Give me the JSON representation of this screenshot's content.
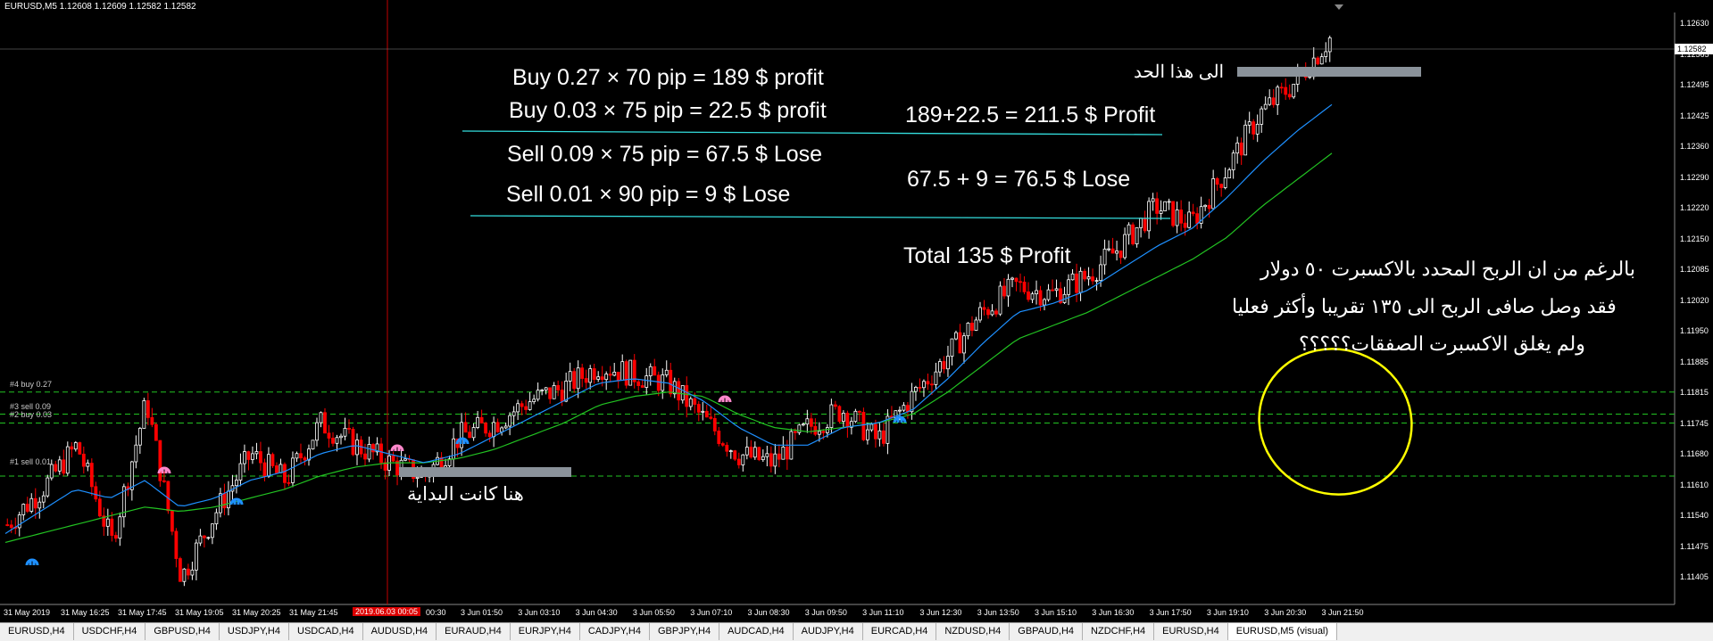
{
  "symbol_info": "EURUSD,M5  1.12608 1.12609 1.12582 1.12582",
  "current_price": "1.12582",
  "price_ticks": [
    "1.12630",
    "1.12565",
    "1.12495",
    "1.12425",
    "1.12360",
    "1.12290",
    "1.12220",
    "1.12150",
    "1.12085",
    "1.12020",
    "1.11950",
    "1.11885",
    "1.11815",
    "1.11745",
    "1.11680",
    "1.11610",
    "1.11540",
    "1.11475",
    "1.11405"
  ],
  "time_ticks": [
    "31 May 2019",
    "31 May 16:25",
    "31 May 17:45",
    "31 May 19:05",
    "31 May 20:25",
    "31 May 21:45",
    "2019.06.03 00:05",
    "00:30",
    "3 Jun 01:50",
    "3 Jun 03:10",
    "3 Jun 04:30",
    "3 Jun 05:50",
    "3 Jun 07:10",
    "3 Jun 08:30",
    "3 Jun 09:50",
    "3 Jun 11:10",
    "3 Jun 12:30",
    "3 Jun 13:50",
    "3 Jun 15:10",
    "3 Jun 16:30",
    "3 Jun 17:50",
    "3 Jun 19:10",
    "3 Jun 20:30",
    "3 Jun 21:50"
  ],
  "indicator_labels": [
    "#4 buy 0.27",
    "#3 sell 0.09",
    "#2 buy 0.03",
    "#1 sell 0.01"
  ],
  "annotations": {
    "calc1": "Buy 0.27 × 70 pip = 189 $ profit",
    "calc2": "Buy 0.03 × 75 pip = 22.5 $ profit",
    "calc3": "Sell 0.09 × 75 pip = 67.5  $ Lose",
    "calc4": "Sell 0.01 × 90 pip = 9  $ Lose",
    "sum_profit": "189+22.5 = 211.5 $ Profit",
    "sum_lose": "67.5  + 9 =  76.5 $ Lose",
    "total": "Total  135 $ Profit",
    "arabic_top": "الى هذا الحد",
    "arabic_start": "هنا كانت البداية",
    "arabic_note1": "بالرغم من ان الربح المحدد بالاكسبرت ٥٠ دولار",
    "arabic_note2": "فقد وصل صافى الربح الى ١٣٥ تقريبا وأكثر فعليا",
    "arabic_note3": "ولم يغلق الاكسبرت الصفقات؟؟؟؟؟"
  },
  "tabs": [
    {
      "label": "EURUSD,H4",
      "active": false
    },
    {
      "label": "USDCHF,H4",
      "active": false
    },
    {
      "label": "GBPUSD,H4",
      "active": false
    },
    {
      "label": "USDJPY,H4",
      "active": false
    },
    {
      "label": "USDCAD,H4",
      "active": false
    },
    {
      "label": "AUDUSD,H4",
      "active": false
    },
    {
      "label": "EURAUD,H4",
      "active": false
    },
    {
      "label": "EURJPY,H4",
      "active": false
    },
    {
      "label": "CADJPY,H4",
      "active": false
    },
    {
      "label": "GBPJPY,H4",
      "active": false
    },
    {
      "label": "AUDCAD,H4",
      "active": false
    },
    {
      "label": "AUDJPY,H4",
      "active": false
    },
    {
      "label": "EURCAD,H4",
      "active": false
    },
    {
      "label": "NZDUSD,H4",
      "active": false
    },
    {
      "label": "GBPAUD,H4",
      "active": false
    },
    {
      "label": "NZDCHF,H4",
      "active": false
    },
    {
      "label": "EURUSD,H4",
      "active": false
    },
    {
      "label": "EURUSD,M5 (visual)",
      "active": true
    }
  ],
  "colors": {
    "background": "#000000",
    "bull_candle": "#ffffff",
    "bear_candle": "#ff0000",
    "ma_fast": "#1e90ff",
    "ma_slow": "#22c322",
    "order_level": "#22c322",
    "highlight_ellipse": "#ffff00",
    "vertical_line": "#c00000"
  },
  "chart_data": {
    "type": "candlestick",
    "symbol": "EURUSD",
    "timeframe": "M5",
    "y_range": [
      1.1138,
      1.1265
    ],
    "x_labels": [
      "31 May 2019",
      "31 May 16:25",
      "31 May 17:45",
      "31 May 19:05",
      "31 May 20:25",
      "31 May 21:45",
      "2019.06.03 00:05",
      "00:30",
      "3 Jun 01:50",
      "3 Jun 03:10",
      "3 Jun 04:30",
      "3 Jun 05:50",
      "3 Jun 07:10",
      "3 Jun 08:30",
      "3 Jun 09:50",
      "3 Jun 11:10",
      "3 Jun 12:30",
      "3 Jun 13:50",
      "3 Jun 15:10",
      "3 Jun 16:30",
      "3 Jun 17:50",
      "3 Jun 19:10",
      "3 Jun 20:30",
      "3 Jun 21:50"
    ],
    "price_path": [
      1.1152,
      1.116,
      1.117,
      1.1148,
      1.118,
      1.114,
      1.1155,
      1.1168,
      1.1162,
      1.1175,
      1.117,
      1.1166,
      1.1163,
      1.1172,
      1.1175,
      1.118,
      1.1183,
      1.1188,
      1.1186,
      1.1184,
      1.1176,
      1.1168,
      1.1166,
      1.1174,
      1.1178,
      1.1171,
      1.1181,
      1.119,
      1.12,
      1.1206,
      1.1204,
      1.1208,
      1.1215,
      1.1224,
      1.122,
      1.1232,
      1.1245,
      1.1252,
      1.1262
    ],
    "ma_fast": [
      1.115,
      1.1155,
      1.116,
      1.1158,
      1.1162,
      1.1156,
      1.1158,
      1.1162,
      1.1164,
      1.1168,
      1.117,
      1.1168,
      1.1166,
      1.1168,
      1.1172,
      1.1176,
      1.118,
      1.1184,
      1.1185,
      1.1184,
      1.118,
      1.1174,
      1.117,
      1.117,
      1.1174,
      1.1175,
      1.1178,
      1.1185,
      1.1193,
      1.12,
      1.1202,
      1.1205,
      1.121,
      1.1215,
      1.1219,
      1.1226,
      1.1234,
      1.1241,
      1.1247
    ],
    "ma_slow": [
      1.1148,
      1.115,
      1.1152,
      1.1154,
      1.1156,
      1.1155,
      1.1156,
      1.1158,
      1.116,
      1.1163,
      1.1165,
      1.1166,
      1.1166,
      1.1167,
      1.1169,
      1.1172,
      1.1175,
      1.1179,
      1.1181,
      1.1182,
      1.1181,
      1.1177,
      1.1174,
      1.1173,
      1.1174,
      1.1175,
      1.1177,
      1.1182,
      1.1188,
      1.1194,
      1.1197,
      1.12,
      1.1204,
      1.1208,
      1.1212,
      1.1217,
      1.1224,
      1.123,
      1.1236
    ],
    "order_levels": [
      {
        "label": "#4 buy 0.27",
        "price": 1.1182
      },
      {
        "label": "#3 sell 0.09",
        "price": 1.1177
      },
      {
        "label": "#2 buy 0.03",
        "price": 1.1175
      },
      {
        "label": "#1 sell 0.01",
        "price": 1.1163
      }
    ]
  }
}
